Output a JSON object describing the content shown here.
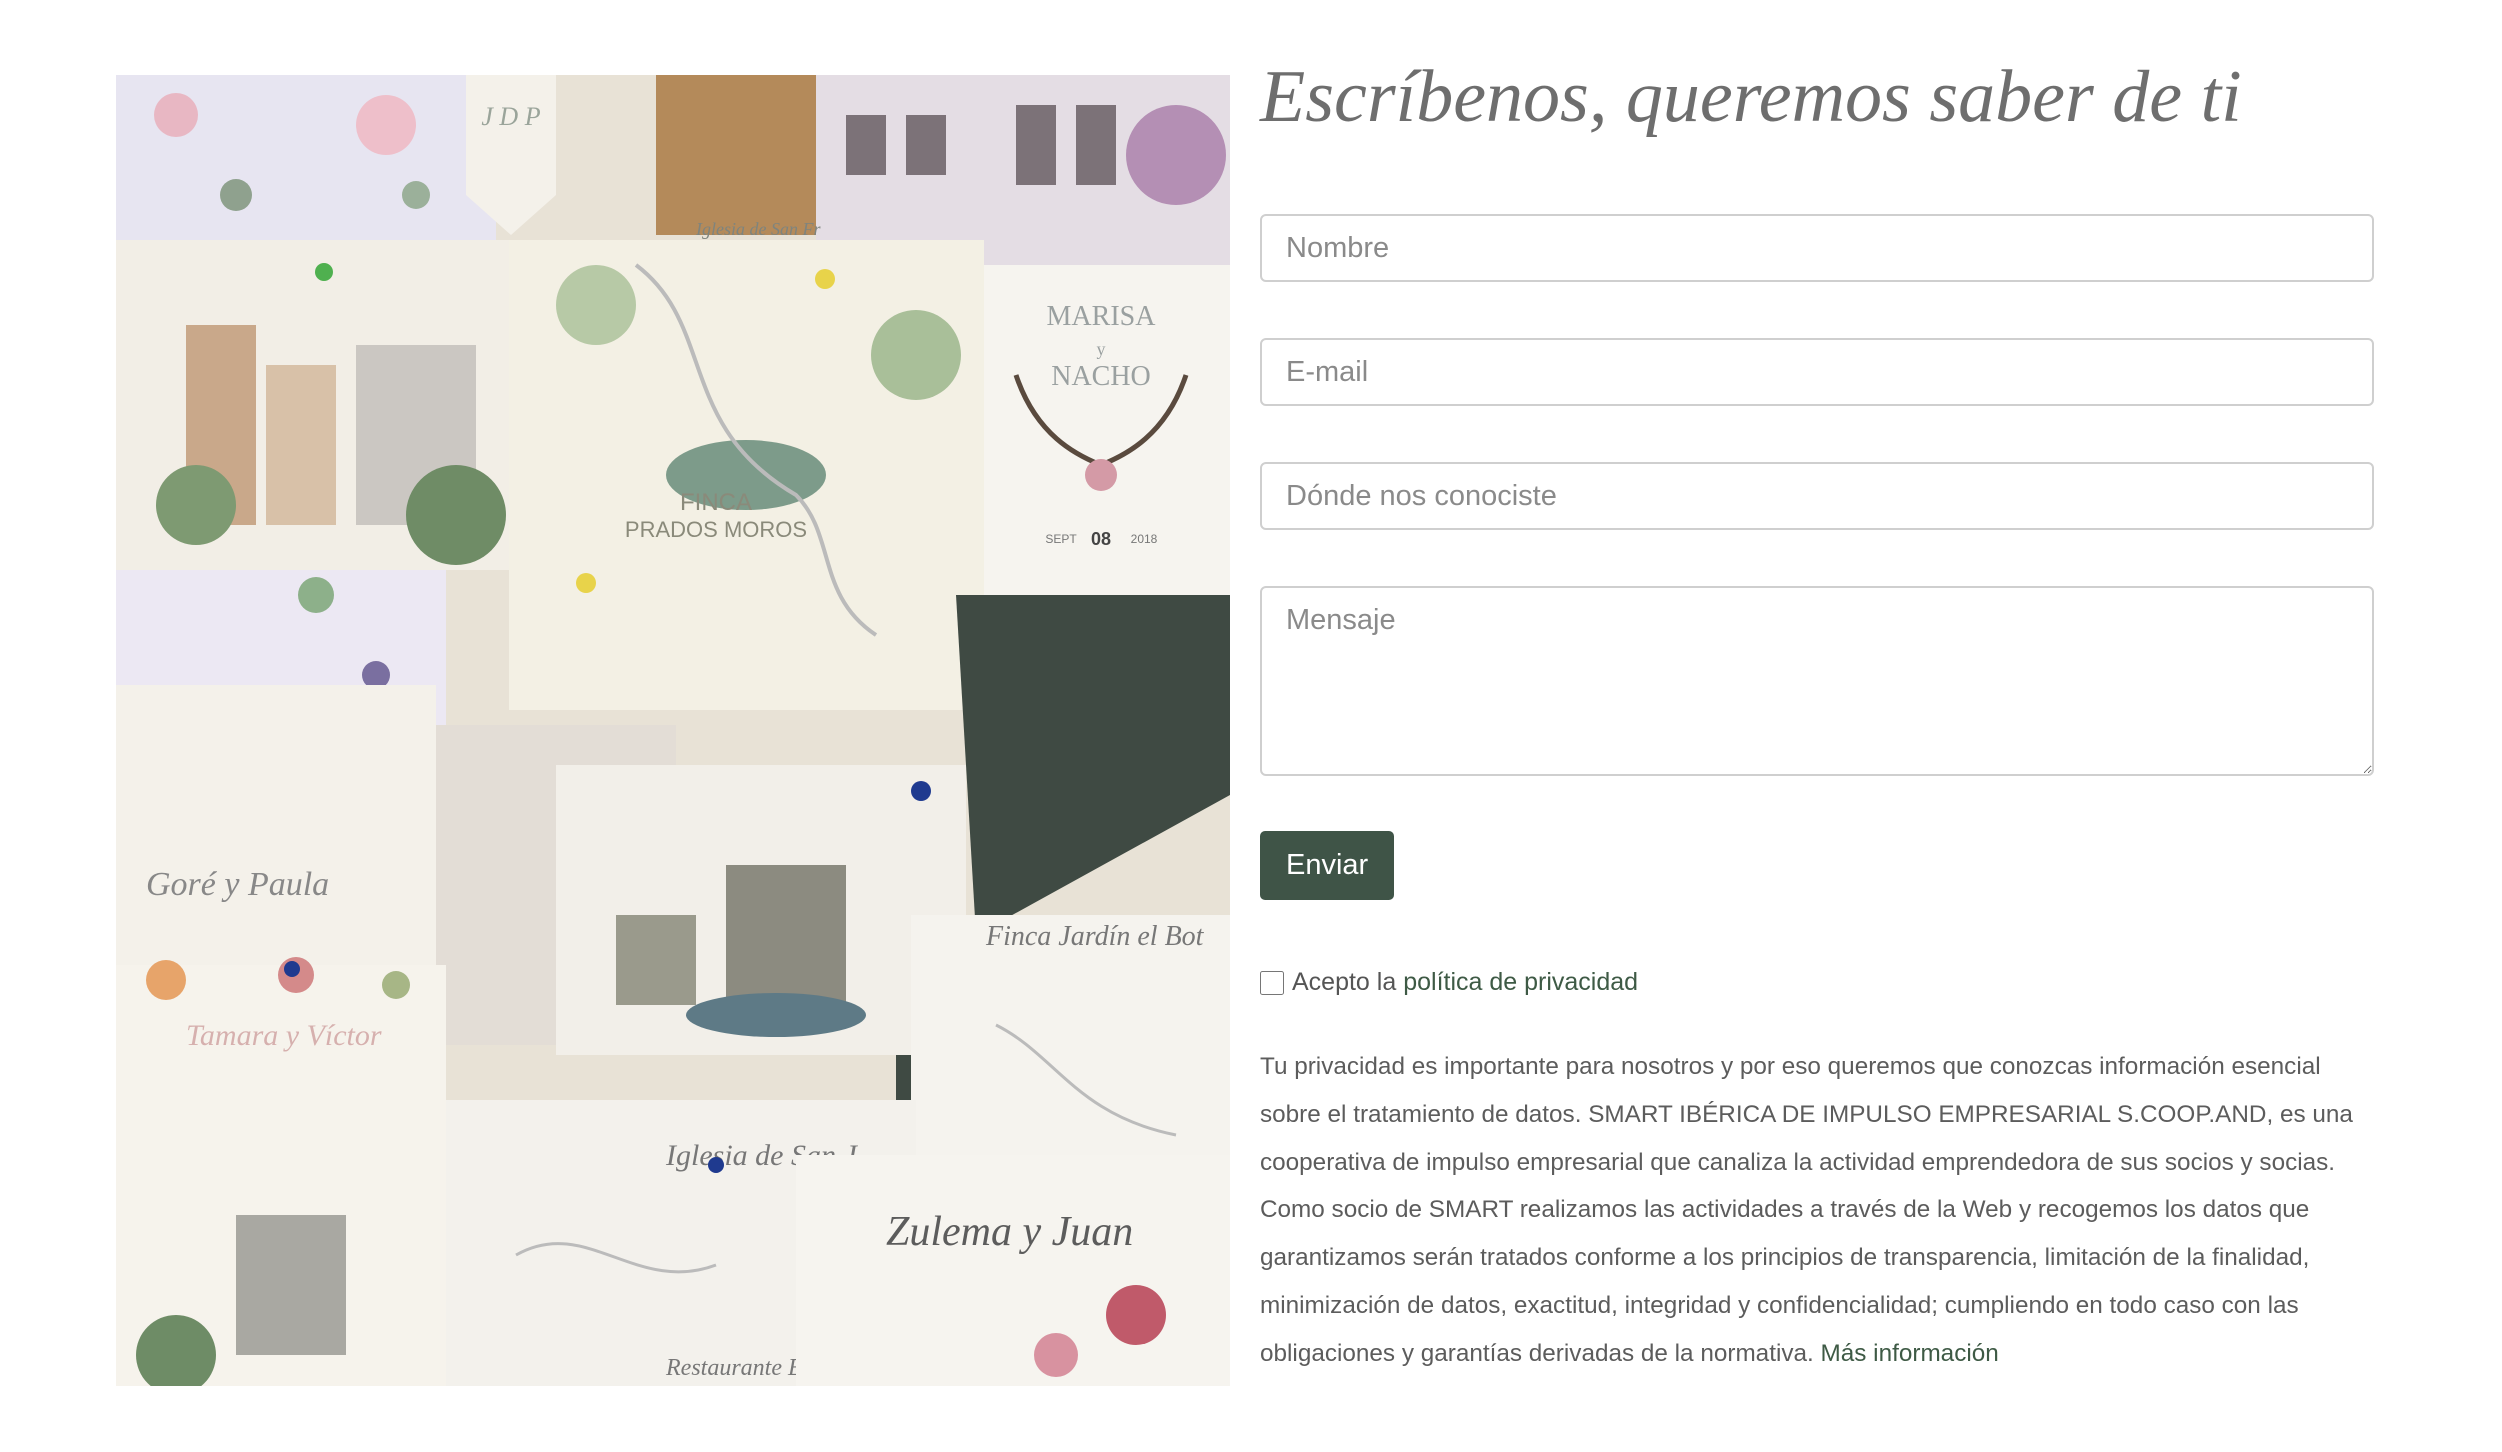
{
  "form": {
    "title": "Escríbenos, queremos saber de ti",
    "name_placeholder": "Nombre",
    "email_placeholder": "E-mail",
    "where_placeholder": "Dónde nos conociste",
    "message_placeholder": "Mensaje",
    "submit_label": "Enviar"
  },
  "consent": {
    "prefix": "Acepto la",
    "link_label": "política de privacidad"
  },
  "privacy": {
    "text": "Tu privacidad es importante para nosotros y por eso queremos que conozcas información esencial sobre el tratamiento de datos. SMART IBÉRICA DE IMPULSO EMPRESARIAL S.COOP.AND, es una cooperativa de impulso empresarial que canaliza la actividad emprendedora de sus socios y socias. Como socio de SMART realizamos las actividades a través de la Web y recogemos los datos que garantizamos serán tratados conforme a los principios de transparencia, limitación de la finalidad, minimización de datos, exactitud, integridad y confidencialidad; cumpliendo en todo caso con las obligaciones y garantías derivadas de la normativa.",
    "more_label": "Más información"
  },
  "collage": {
    "texts": {
      "marisa": "MARISA",
      "y": "y",
      "nacho": "NACHO",
      "sept": "SEPT",
      "day": "08",
      "year": "2018",
      "finca": "FINCA",
      "prados": "PRADOS MOROS",
      "gore": "Goré y Paula",
      "tamara": "Tamara y Víctor",
      "iglesia": "Iglesia de San J",
      "zulema": "Zulema y Juan",
      "jardin": "Finca Jardín el Bot",
      "restaurante": "Restaurante Eu",
      "jdp": "J D P",
      "iglesia_top": "Iglesia de San Fr"
    }
  },
  "colors": {
    "accent": "#3f5447",
    "link": "#3e5a45",
    "title": "#6e6e6e",
    "border": "#cfcfcf"
  }
}
